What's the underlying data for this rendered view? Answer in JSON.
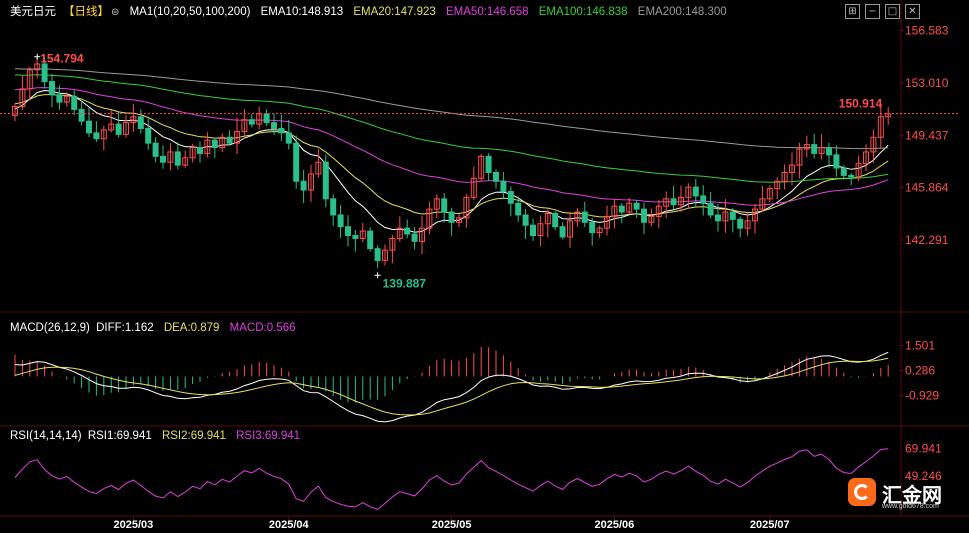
{
  "header": {
    "symbol": "美元日元",
    "period": "【日线】",
    "ma_label": "MA1(10,20,50,100,200)",
    "ema10": "EMA10:148.913",
    "ema20": "EMA20:147.923",
    "ema50": "EMA50:146.658",
    "ema100": "EMA100:146.838",
    "ema200": "EMA200:148.300"
  },
  "macd_header": {
    "label": "MACD(26,12,9)",
    "diff": "DIFF:1.162",
    "dea": "DEA:0.879",
    "macd": "MACD:0.566"
  },
  "rsi_header": {
    "label": "RSI(14,14,14)",
    "rsi1": "RSI1:69.941",
    "rsi2": "RSI2:69.941",
    "rsi3": "RSI3:69.941"
  },
  "logo": {
    "name": "汇金网",
    "url": "www.gold678.com"
  },
  "toolbar_icons": [
    "grid-icon",
    "minus-icon",
    "maximize-icon",
    "close-icon"
  ],
  "colors": {
    "up": "#ff4d4d",
    "down": "#2bbf8a",
    "ema10": "#ffffff",
    "ema20": "#e6e060",
    "ema50": "#e040e0",
    "ema100": "#38d038",
    "ema200": "#9a9a9a",
    "rsi": "#e040e0",
    "grid": "#5a0a0a",
    "axis_text": "#ff4d4d"
  },
  "chart_data": [
    {
      "type": "candlestick",
      "name": "price",
      "y_ticks": [
        "156.583",
        "153.010",
        "149.437",
        "145.864",
        "142.291"
      ],
      "ylim": [
        138.2,
        157.3
      ],
      "x_ticks": [
        "2025/03",
        "2025/04",
        "2025/05",
        "2025/06",
        "2025/07"
      ],
      "x_tick_index": [
        16,
        37,
        59,
        81,
        102
      ],
      "annotations": {
        "high": "154.794",
        "low": "139.887",
        "last": "150.914"
      },
      "high_value": 154.794,
      "low_value": 139.887,
      "last_value": 150.914,
      "closes": [
        151.4,
        152.6,
        153.9,
        154.3,
        153.1,
        152.2,
        151.7,
        152.1,
        151.2,
        150.4,
        149.6,
        149.2,
        149.8,
        150.2,
        149.5,
        150.3,
        150.7,
        149.9,
        148.9,
        148.0,
        147.6,
        148.3,
        147.4,
        147.9,
        148.6,
        148.2,
        149.1,
        148.6,
        149.3,
        148.9,
        149.7,
        150.5,
        150.2,
        150.9,
        150.3,
        149.9,
        149.6,
        148.9,
        146.3,
        145.7,
        146.8,
        147.6,
        145.1,
        144.0,
        143.2,
        142.6,
        142.4,
        142.9,
        141.7,
        140.9,
        141.6,
        142.4,
        143.1,
        142.7,
        142.2,
        143.1,
        144.4,
        145.1,
        144.2,
        143.5,
        143.8,
        145.2,
        146.5,
        148.0,
        146.9,
        146.3,
        145.6,
        144.8,
        144.0,
        143.3,
        142.6,
        143.4,
        144.1,
        143.2,
        142.5,
        143.6,
        144.2,
        143.5,
        142.8,
        143.1,
        143.9,
        144.6,
        144.2,
        144.8,
        144.4,
        143.5,
        143.9,
        144.6,
        145.1,
        144.7,
        145.2,
        145.9,
        145.3,
        144.8,
        144.0,
        143.6,
        144.2,
        143.7,
        143.1,
        143.6,
        144.4,
        145.1,
        145.8,
        146.3,
        146.9,
        147.4,
        148.5,
        148.8,
        148.2,
        148.6,
        148.1,
        147.2,
        146.7,
        146.6,
        147.5,
        148.3,
        149.3,
        150.7,
        150.9
      ]
    },
    {
      "type": "bar+line",
      "name": "macd",
      "y_ticks": [
        "1.501",
        "0.286",
        "-0.929"
      ],
      "ylim": [
        -2.2,
        2.15
      ],
      "series": [
        {
          "name": "DIFF",
          "last": 1.162
        },
        {
          "name": "DEA",
          "last": 0.879
        },
        {
          "name": "MACD",
          "last": 0.566
        }
      ]
    },
    {
      "type": "line",
      "name": "rsi",
      "y_ticks": [
        "69.941",
        "49.246"
      ],
      "ylim": [
        20,
        78
      ],
      "series": [
        {
          "name": "RSI1",
          "last": 69.941
        }
      ]
    }
  ]
}
